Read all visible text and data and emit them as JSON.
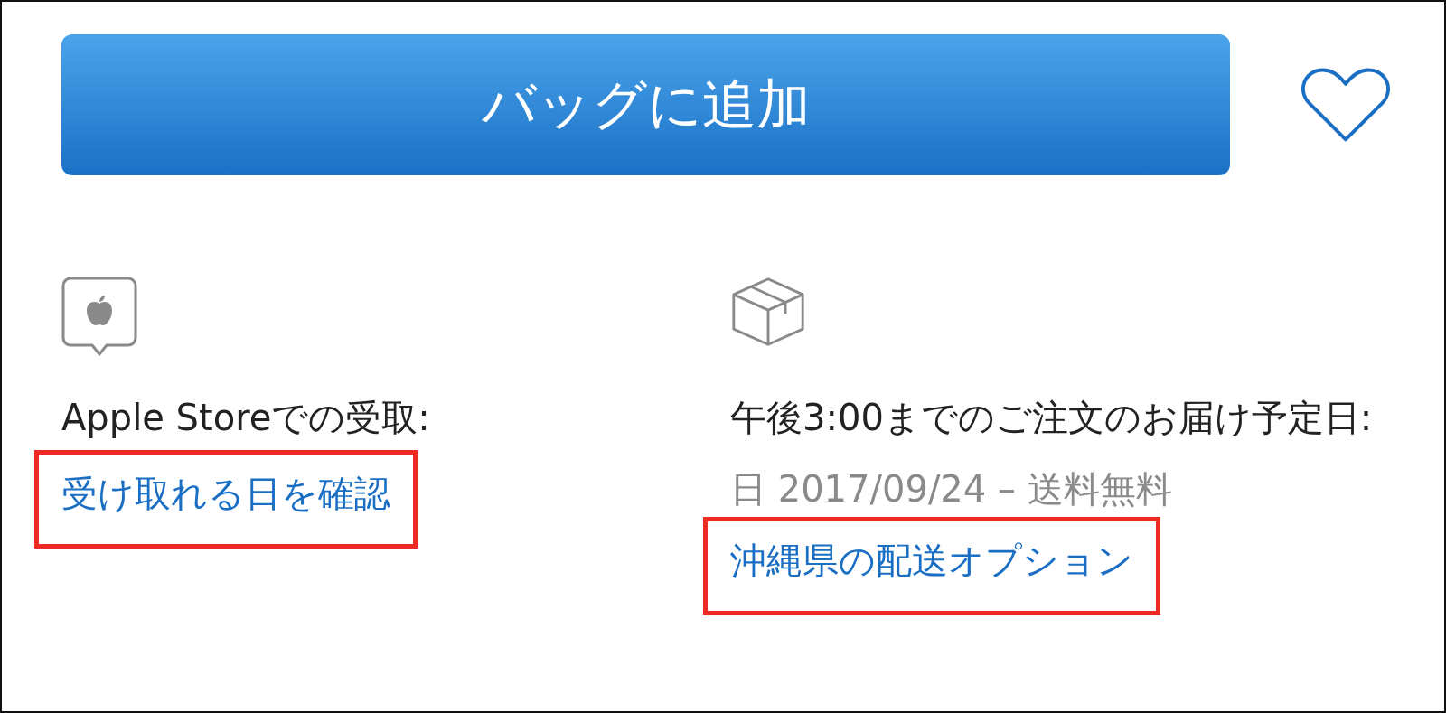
{
  "add_to_bag_button": {
    "label": "バッグに追加"
  },
  "favorite": {
    "selected": false
  },
  "pickup": {
    "title": "Apple Storeでの受取:",
    "link": {
      "label": "受け取れる日を確認",
      "highlighted": true
    }
  },
  "delivery": {
    "title": "午後3:00までのご注文のお届け予定日:",
    "date": "日 2017/09/24 – 送料無料",
    "link": {
      "label": "沖縄県の配送オプション",
      "highlighted": true
    }
  }
}
